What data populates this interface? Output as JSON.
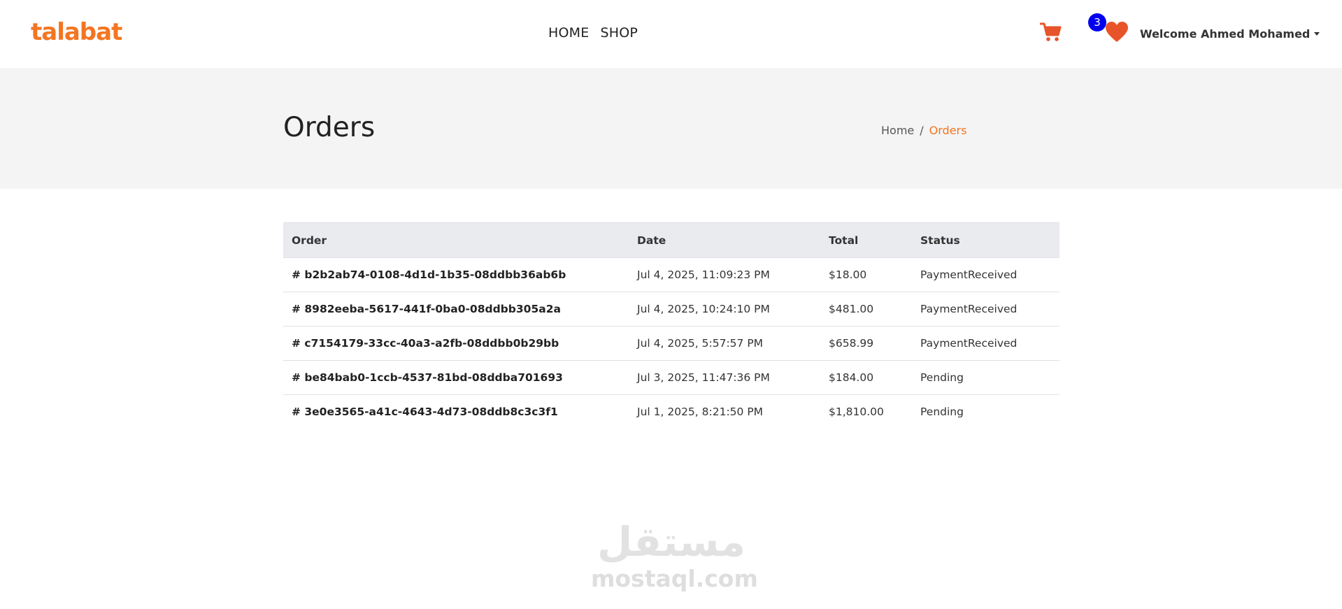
{
  "header": {
    "logo": "talabat",
    "nav": [
      {
        "label": "HOME"
      },
      {
        "label": "SHOP"
      }
    ],
    "cart_icon": "shopping-cart-icon",
    "wishlist_icon": "heart-icon",
    "wishlist_count": "3",
    "user_menu": "Welcome Ahmed Mohamed",
    "colors": {
      "brand": "#f47521",
      "badge": "#0000ee",
      "icon": "#e8542a"
    }
  },
  "page": {
    "title": "Orders",
    "breadcrumb": {
      "home": "Home",
      "separator": "/",
      "current": "Orders"
    }
  },
  "table": {
    "headers": {
      "order": "Order",
      "date": "Date",
      "total": "Total",
      "status": "Status"
    },
    "rows": [
      {
        "order": "# b2b2ab74-0108-4d1d-1b35-08ddbb36ab6b",
        "date": "Jul 4, 2025, 11:09:23 PM",
        "total": "$18.00",
        "status": "PaymentReceived"
      },
      {
        "order": "# 8982eeba-5617-441f-0ba0-08ddbb305a2a",
        "date": "Jul 4, 2025, 10:24:10 PM",
        "total": "$481.00",
        "status": "PaymentReceived"
      },
      {
        "order": "# c7154179-33cc-40a3-a2fb-08ddbb0b29bb",
        "date": "Jul 4, 2025, 5:57:57 PM",
        "total": "$658.99",
        "status": "PaymentReceived"
      },
      {
        "order": "# be84bab0-1ccb-4537-81bd-08ddba701693",
        "date": "Jul 3, 2025, 11:47:36 PM",
        "total": "$184.00",
        "status": "Pending"
      },
      {
        "order": "# 3e0e3565-a41c-4643-4d73-08ddb8c3c3f1",
        "date": "Jul 1, 2025, 8:21:50 PM",
        "total": "$1,810.00",
        "status": "Pending"
      }
    ]
  },
  "watermark": {
    "arabic": "مستقل",
    "latin": "mostaql.com"
  }
}
